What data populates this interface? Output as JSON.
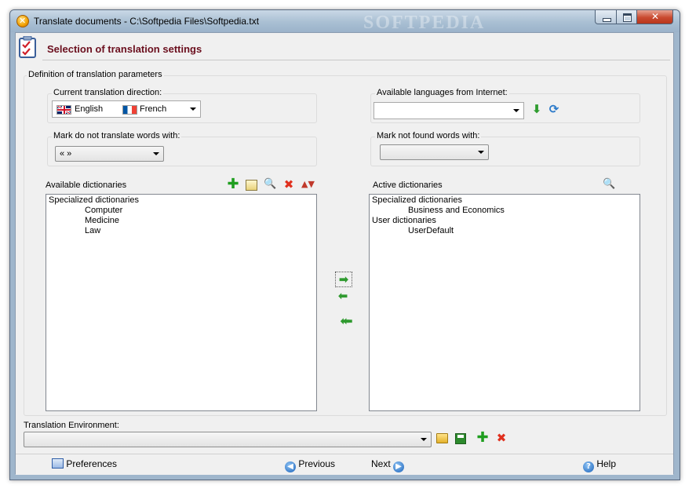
{
  "window": {
    "title": "Translate documents - C:\\Softpedia Files\\Softpedia.txt",
    "watermark": "SOFTPEDIA"
  },
  "header": {
    "title": "Selection of translation settings"
  },
  "definition_group": {
    "label": "Definition of translation parameters"
  },
  "direction": {
    "label": "Current translation direction:",
    "source_language": "English",
    "target_language": "French"
  },
  "available_languages": {
    "label": "Available languages from Internet:",
    "value": ""
  },
  "dnt_mark": {
    "label": "Mark do not translate words with:",
    "value": "«   »"
  },
  "not_found_mark": {
    "label": "Mark not found words with:",
    "value": ""
  },
  "available_dictionaries": {
    "label": "Available dictionaries",
    "items": [
      {
        "text": "Specialized dictionaries",
        "level": 0
      },
      {
        "text": "Computer",
        "level": 1
      },
      {
        "text": "Medicine",
        "level": 1
      },
      {
        "text": "Law",
        "level": 1
      }
    ]
  },
  "active_dictionaries": {
    "label": "Active dictionaries",
    "items": [
      {
        "text": "Specialized dictionaries",
        "level": 0
      },
      {
        "text": "Business and Economics",
        "level": 1
      },
      {
        "text": "User dictionaries",
        "level": 0
      },
      {
        "text": "UserDefault",
        "level": 1
      }
    ]
  },
  "environment": {
    "label": "Translation Environment:",
    "value": ""
  },
  "footer": {
    "preferences": "Preferences",
    "previous": "Previous",
    "next": "Next",
    "help": "Help"
  }
}
